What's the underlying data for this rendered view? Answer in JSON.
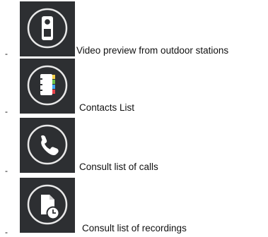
{
  "bullet": "-",
  "items": [
    {
      "icon": "intercom-panel-icon",
      "label": "Video preview from outdoor stations"
    },
    {
      "icon": "address-book-icon",
      "label": "Contacts List"
    },
    {
      "icon": "phone-handset-icon",
      "label": "Consult list of calls"
    },
    {
      "icon": "recording-document-clock-icon",
      "label": "Consult list of recordings"
    }
  ],
  "colors": {
    "tile_background": "#2d2f32",
    "ring": "#e8e8e8",
    "icon_fill": "#ffffff",
    "tab_colors": [
      "#f5d24a",
      "#6cc24a",
      "#3fa9f5",
      "#e8424a"
    ]
  }
}
